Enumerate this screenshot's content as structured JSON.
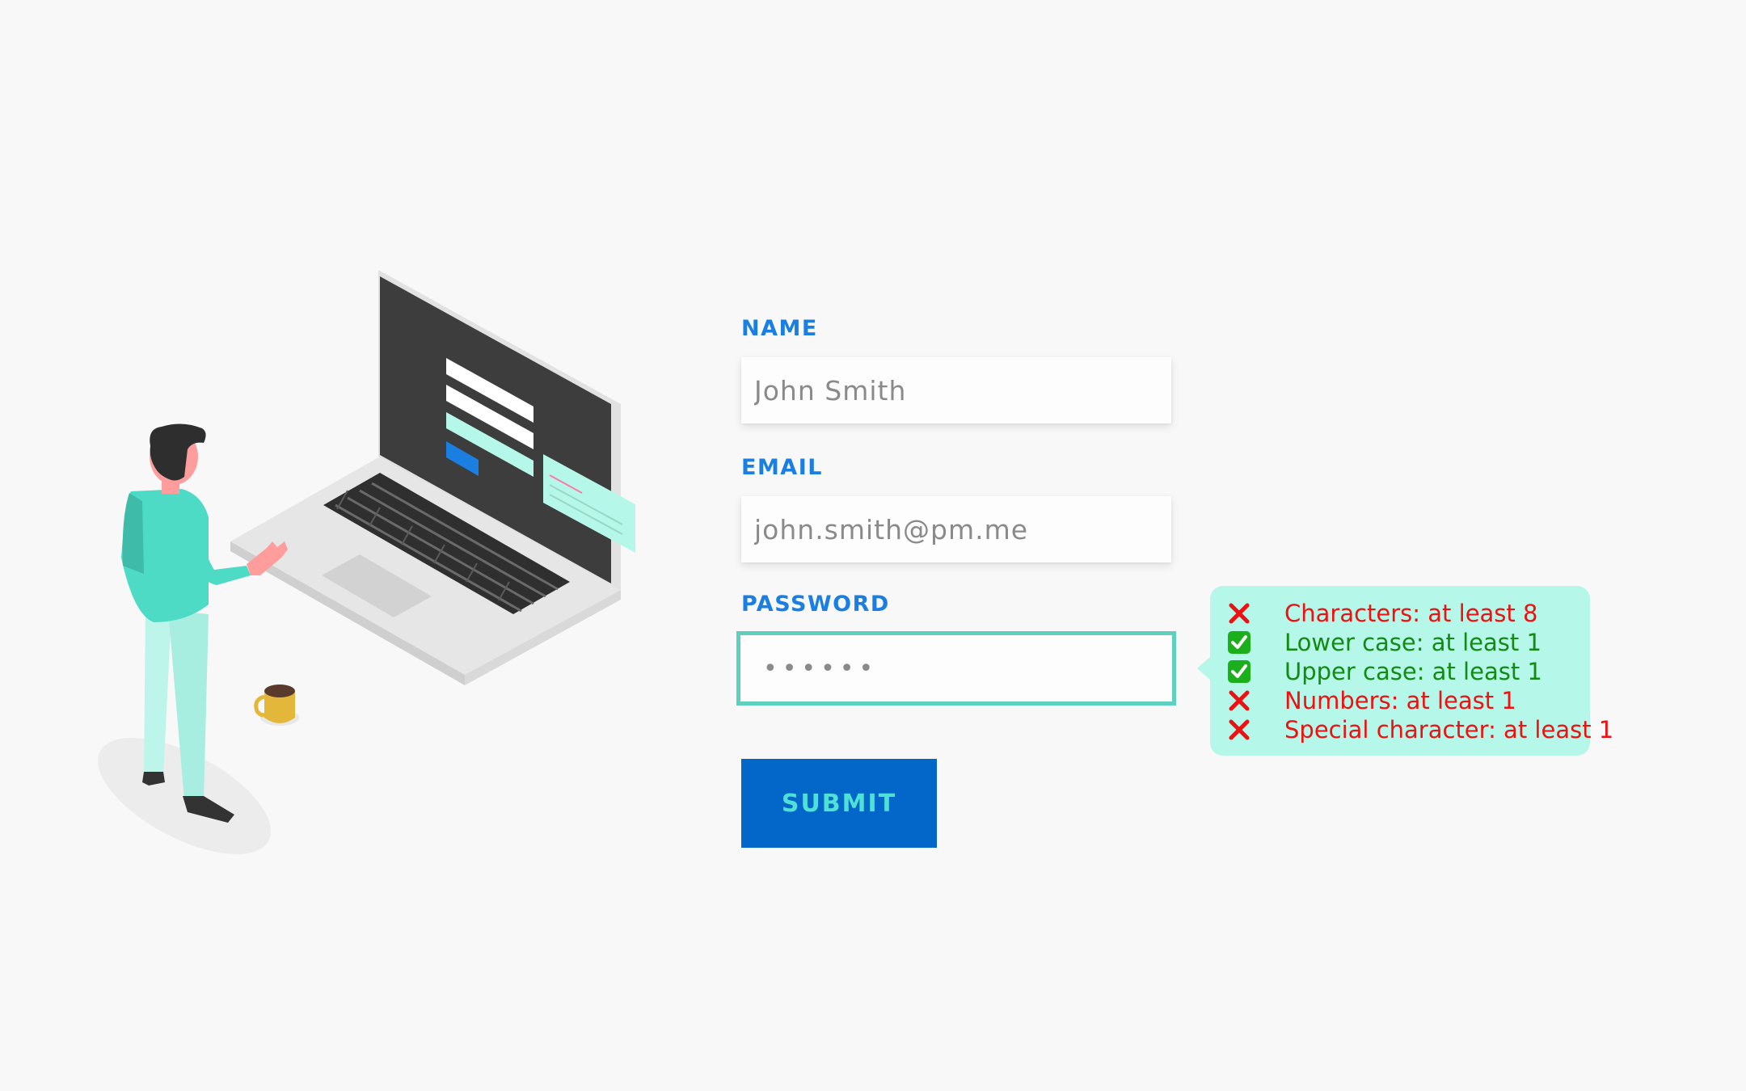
{
  "form": {
    "name": {
      "label": "NAME",
      "placeholder": "John Smith"
    },
    "email": {
      "label": "EMAIL",
      "placeholder": "john.smith@pm.me"
    },
    "password": {
      "label": "PASSWORD",
      "masked_value": "••••••"
    },
    "submit_label": "SUBMIT"
  },
  "password_rules": [
    {
      "text": "Characters: at least 8",
      "status": "fail",
      "icon": "cross-icon"
    },
    {
      "text": "Lower case: at least 1",
      "status": "pass",
      "icon": "check-icon"
    },
    {
      "text": "Upper case: at least 1",
      "status": "pass",
      "icon": "check-icon"
    },
    {
      "text": "Numbers: at least 1",
      "status": "fail",
      "icon": "cross-icon"
    },
    {
      "text": "Special character: at least 1",
      "status": "fail",
      "icon": "cross-icon"
    }
  ],
  "colors": {
    "background": "#f8f8f8",
    "label": "#1a7fe0",
    "submit_bg": "#0366c9",
    "submit_text": "#4fe0d6",
    "focus_border": "#5fcfbe",
    "tooltip_bg": "#b5f7e8",
    "fail": "#ee1111",
    "pass": "#138a13"
  }
}
